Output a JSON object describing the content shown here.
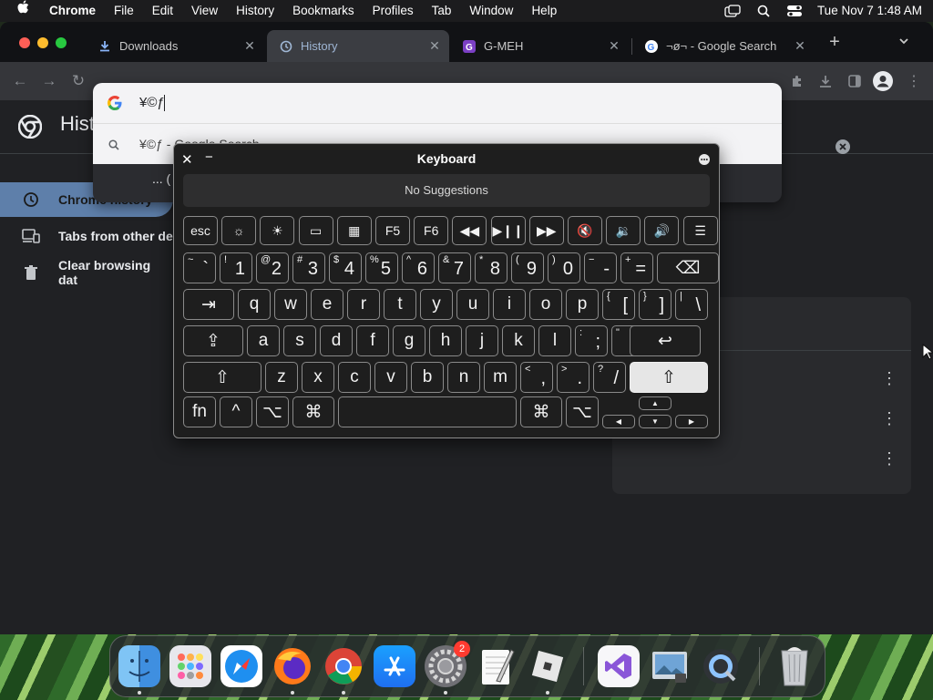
{
  "menubar": {
    "apple_icon": "apple-logo-icon",
    "app_name": "Chrome",
    "menus": [
      "File",
      "Edit",
      "View",
      "History",
      "Bookmarks",
      "Profiles",
      "Tab",
      "Window",
      "Help"
    ],
    "clock": "Tue Nov 7  1:48 AM"
  },
  "tabs": [
    {
      "title": "Downloads",
      "icon": "download-icon",
      "active": false
    },
    {
      "title": "History",
      "icon": "history-icon",
      "active": true
    },
    {
      "title": "G-MEH",
      "icon": "app-icon",
      "active": false
    },
    {
      "title": "¬ø¬ - Google Search",
      "icon": "google-icon",
      "active": false
    }
  ],
  "history_page": {
    "title": "Hist",
    "sidebar": [
      {
        "label": "Chrome history",
        "icon": "history-icon",
        "selected": true
      },
      {
        "label": "Tabs from other de",
        "icon": "devices-icon",
        "selected": false
      },
      {
        "label": "Clear browsing dat",
        "icon": "trash-icon",
        "selected": false
      }
    ]
  },
  "omnibox": {
    "input": "¥©ƒ",
    "suggestion": "¥©ƒ - Google Search",
    "partial_row": "... ("
  },
  "keyboard": {
    "title": "Keyboard",
    "suggestions": "No Suggestions",
    "fn_row": [
      {
        "label": "esc"
      },
      {
        "icon": "brightness-down-icon",
        "glyph": "☼"
      },
      {
        "icon": "brightness-up-icon",
        "glyph": "☀"
      },
      {
        "icon": "mission-control-icon",
        "glyph": "▭"
      },
      {
        "icon": "launchpad-icon",
        "glyph": "▦"
      },
      {
        "label": "F5"
      },
      {
        "label": "F6"
      },
      {
        "icon": "rewind-icon",
        "glyph": "◀◀"
      },
      {
        "icon": "play-pause-icon",
        "glyph": "▶❙❙"
      },
      {
        "icon": "fast-forward-icon",
        "glyph": "▶▶"
      },
      {
        "icon": "mute-icon",
        "glyph": "🔇"
      },
      {
        "icon": "volume-down-icon",
        "glyph": "🔉"
      },
      {
        "icon": "volume-up-icon",
        "glyph": "🔊"
      },
      {
        "icon": "menu-icon",
        "glyph": "☰"
      }
    ],
    "number_row": [
      {
        "top": "~",
        "main": "`"
      },
      {
        "top": "!",
        "main": "1"
      },
      {
        "top": "@",
        "main": "2"
      },
      {
        "top": "#",
        "main": "3"
      },
      {
        "top": "$",
        "main": "4"
      },
      {
        "top": "%",
        "main": "5"
      },
      {
        "top": "^",
        "main": "6"
      },
      {
        "top": "&",
        "main": "7"
      },
      {
        "top": "*",
        "main": "8"
      },
      {
        "top": "(",
        "main": "9"
      },
      {
        "top": ")",
        "main": "0"
      },
      {
        "top": "−",
        "main": "-"
      },
      {
        "top": "+",
        "main": "="
      },
      {
        "main": "⌫"
      }
    ],
    "qwerty_row": [
      "⇥",
      "q",
      "w",
      "e",
      "r",
      "t",
      "y",
      "u",
      "i",
      "o",
      "p",
      {
        "top": "{",
        "main": "["
      },
      {
        "top": "}",
        "main": "]"
      },
      {
        "top": "|",
        "main": "\\"
      }
    ],
    "home_row": [
      "⇪",
      "a",
      "s",
      "d",
      "f",
      "g",
      "h",
      "j",
      "k",
      "l",
      {
        "top": ":",
        "main": ";"
      },
      {
        "top": "\"",
        "main": "'"
      },
      "↩"
    ],
    "shift_row": [
      "⇧",
      "z",
      "x",
      "c",
      "v",
      "b",
      "n",
      "m",
      {
        "top": "<",
        "main": ","
      },
      {
        "top": ">",
        "main": "."
      },
      {
        "top": "?",
        "main": "/"
      },
      "⇧"
    ],
    "bottom_row": [
      "fn",
      "^",
      "⌥",
      "⌘",
      "",
      "⌘",
      "⌥"
    ],
    "arrows": {
      "up": "▲",
      "left": "◀",
      "down": "▼",
      "right": "▶"
    }
  },
  "dock": {
    "apps": [
      "Finder",
      "Launchpad",
      "Safari",
      "Firefox",
      "Chrome",
      "App Store",
      "System Settings",
      "TextEdit",
      "Roblox",
      "Visual Studio",
      "Preview",
      "QuickTime Player",
      "Trash"
    ],
    "settings_badge": "2"
  }
}
